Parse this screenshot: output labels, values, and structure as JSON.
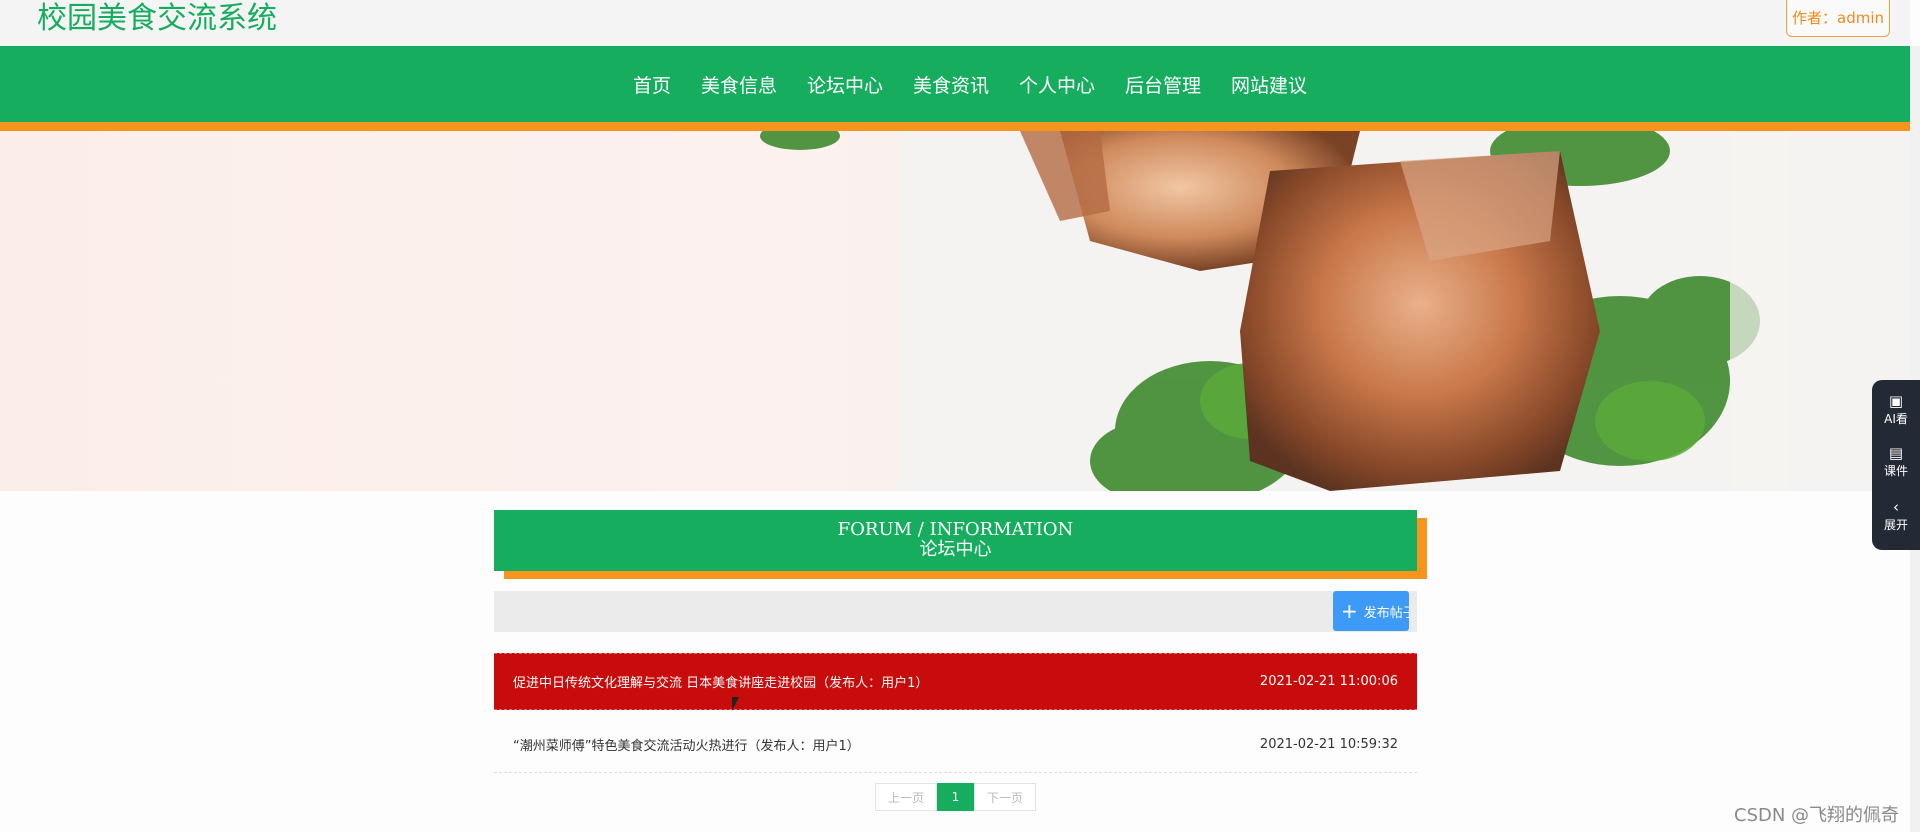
{
  "header": {
    "site_title": "校园美食交流系统",
    "author_label": "作者：admin"
  },
  "nav": {
    "items": [
      "首页",
      "美食信息",
      "论坛中心",
      "美食资讯",
      "个人中心",
      "后台管理",
      "网站建议"
    ]
  },
  "banner": {
    "slides": 3,
    "active_slide": 1
  },
  "forum": {
    "title_en": "FORUM / INFORMATION",
    "title_zh": "论坛中心",
    "publish_button": "发布帖子",
    "posts": [
      {
        "title": "促进中日传统文化理解与交流 日本美食讲座走进校园（发布人：用户1）",
        "time": "2021-02-21 11:00:06",
        "highlighted": true
      },
      {
        "title": "“潮州菜师傅”特色美食交流活动火热进行（发布人：用户1）",
        "time": "2021-02-21 10:59:32",
        "highlighted": false
      }
    ]
  },
  "pagination": {
    "prev": "上一页",
    "current": "1",
    "next": "下一页"
  },
  "side_widget": {
    "items": [
      {
        "label": "AI看",
        "icon": "ai-icon"
      },
      {
        "label": "课件",
        "icon": "book-icon"
      },
      {
        "label": "展开",
        "icon": "chevron-left-icon"
      }
    ]
  },
  "watermark": "CSDN @飞翔的佩奇",
  "colors": {
    "brand_green": "#16ad5f",
    "accent_orange": "#f7941d",
    "highlight_red": "#c80b0b",
    "button_blue": "#3e9af7"
  }
}
